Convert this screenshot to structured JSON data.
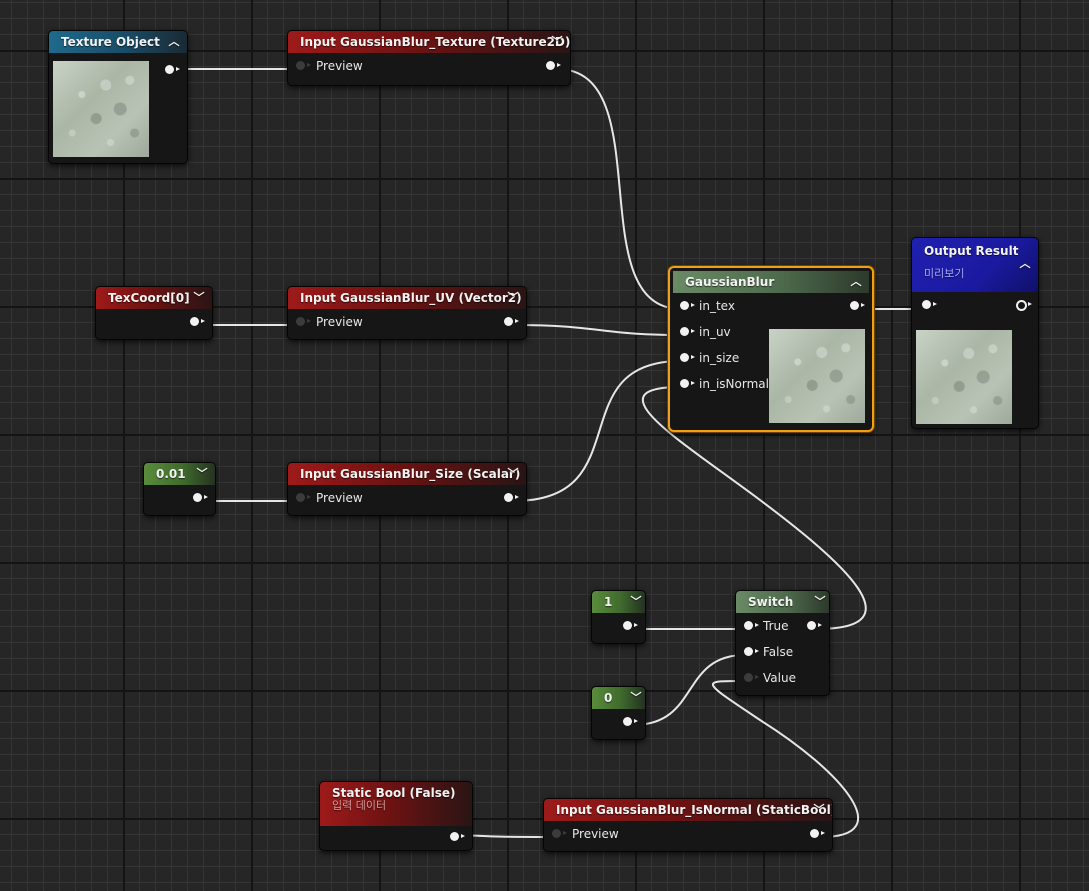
{
  "nodes": {
    "texture_object": {
      "title": "Texture Object"
    },
    "input_texture": {
      "title": "Input GaussianBlur_Texture (Texture2D)",
      "pin": "Preview"
    },
    "texcoord": {
      "title": "TexCoord[0]"
    },
    "input_uv": {
      "title": "Input GaussianBlur_UV (Vector2)",
      "pin": "Preview"
    },
    "scalar_const": {
      "title": "0.01"
    },
    "input_size": {
      "title": "Input GaussianBlur_Size (Scalar)",
      "pin": "Preview"
    },
    "gaussian_blur": {
      "title": "GaussianBlur",
      "pins": [
        "in_tex",
        "in_uv",
        "in_size",
        "in_isNormal"
      ]
    },
    "output_result": {
      "title": "Output Result",
      "subtitle": "미리보기"
    },
    "const_one": {
      "title": "1"
    },
    "const_zero": {
      "title": "0"
    },
    "switch": {
      "title": "Switch",
      "pins": [
        "True",
        "False",
        "Value"
      ]
    },
    "static_bool": {
      "title": "Static Bool (False)",
      "subtitle": "입력 데이터"
    },
    "input_isnormal": {
      "title": "Input GaussianBlur_IsNormal (StaticBool)",
      "pin": "Preview"
    }
  },
  "icons": {
    "expand": "chevron-down-icon",
    "collapse": "chevron-up-icon"
  },
  "colors": {
    "selected_outline": "#f0a012",
    "param_header": "#9e1a1a",
    "texture_header": "#1f6a8c",
    "constant_header": "#5a8c3c",
    "output_header": "#2020b0",
    "wire": "#e6e6e6"
  }
}
